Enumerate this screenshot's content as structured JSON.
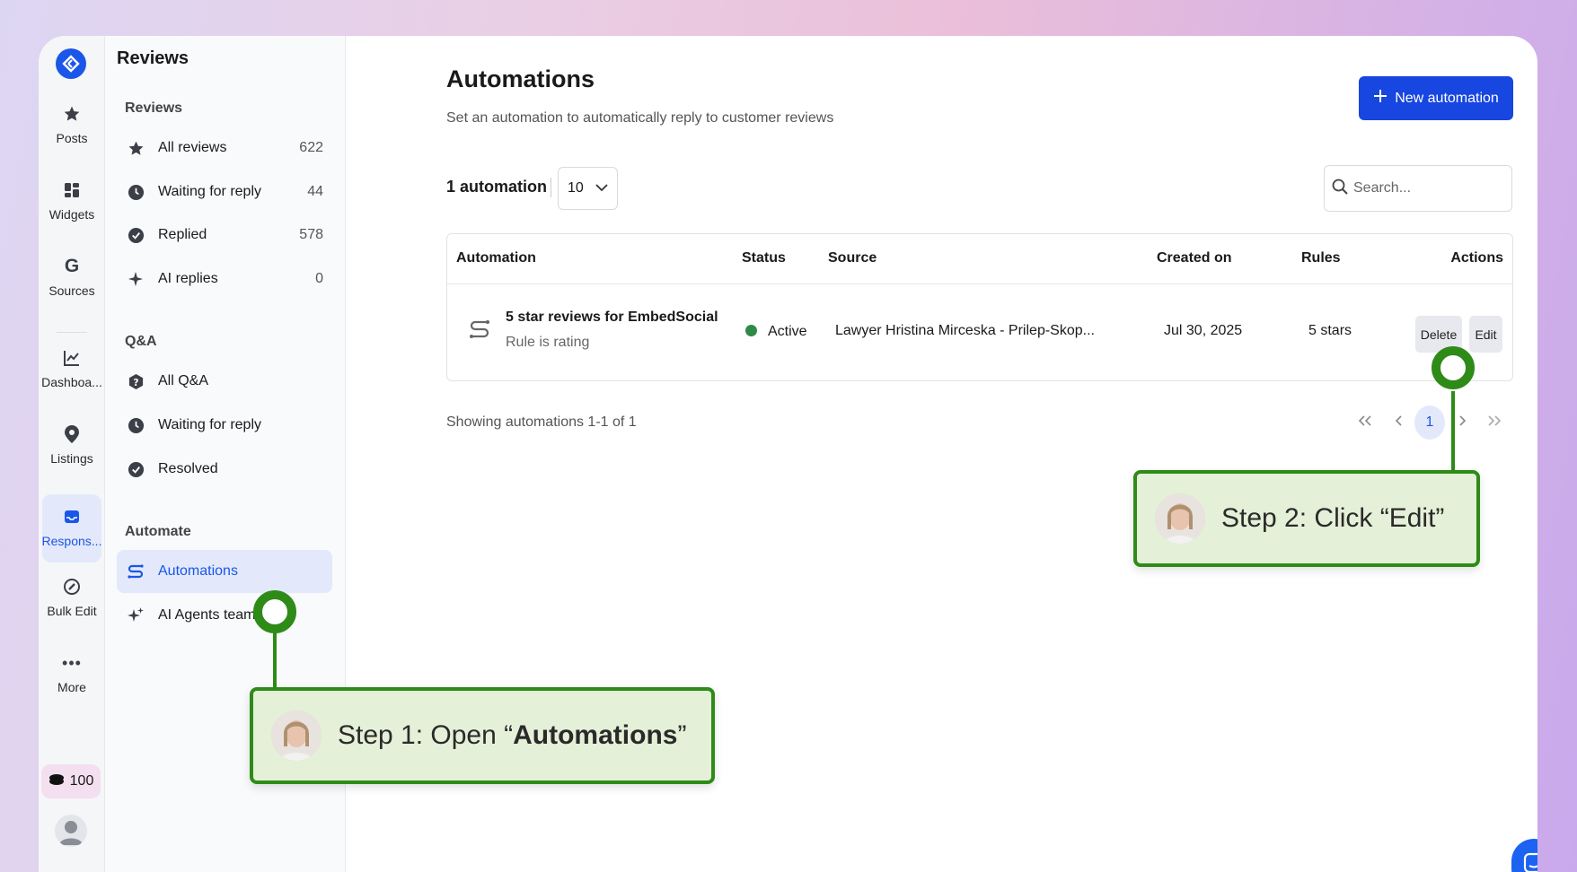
{
  "rail": {
    "items": [
      {
        "label": "Posts",
        "icon": "star-icon"
      },
      {
        "label": "Widgets",
        "icon": "widgets-icon"
      },
      {
        "label": "Sources",
        "icon": "google-icon"
      },
      {
        "label": "Dashboa...",
        "icon": "chart-line-icon"
      },
      {
        "label": "Listings",
        "icon": "map-pin-icon"
      },
      {
        "label": "Respons...",
        "icon": "inbox-icon"
      },
      {
        "label": "Bulk Edit",
        "icon": "edit-icon"
      },
      {
        "label": "More",
        "icon": "dots-icon"
      }
    ],
    "credits": "100"
  },
  "sidebar": {
    "title": "Reviews",
    "sections": {
      "reviews": "Reviews",
      "qa": "Q&A",
      "automate": "Automate"
    },
    "reviews_items": [
      {
        "label": "All reviews",
        "count": "622"
      },
      {
        "label": "Waiting for reply",
        "count": "44"
      },
      {
        "label": "Replied",
        "count": "578"
      },
      {
        "label": "AI replies",
        "count": "0"
      }
    ],
    "qa_items": [
      {
        "label": "All Q&A"
      },
      {
        "label": "Waiting for reply"
      },
      {
        "label": "Resolved"
      }
    ],
    "automate_items": [
      {
        "label": "Automations"
      },
      {
        "label": "AI Agents team"
      }
    ]
  },
  "main": {
    "title": "Automations",
    "subtitle": "Set an automation to automatically reply to customer reviews",
    "new_button": "New automation",
    "count_label": "1 automation",
    "per_page": "10",
    "search_placeholder": "Search...",
    "columns": [
      "Automation",
      "Status",
      "Source",
      "Created on",
      "Rules",
      "Actions"
    ],
    "rows": [
      {
        "name": "5 star reviews for EmbedSocial",
        "sub": "Rule is rating",
        "status": "Active",
        "source": "Lawyer Hristina Mirceska - Prilep-Skop...",
        "created": "Jul 30, 2025",
        "rules": "5 stars",
        "delete": "Delete",
        "edit": "Edit"
      }
    ],
    "showing": "Showing automations 1-1 of 1",
    "pagination": {
      "current": "1"
    }
  },
  "callouts": {
    "step1_prefix": "Step 1: Open “",
    "step1_bold": "Automations",
    "step1_suffix": "”",
    "step2": "Step 2: Click “Edit”"
  },
  "colors": {
    "accent": "#1a56e8",
    "status_active": "#2f8a4a",
    "callout_green": "#2e8b17"
  }
}
